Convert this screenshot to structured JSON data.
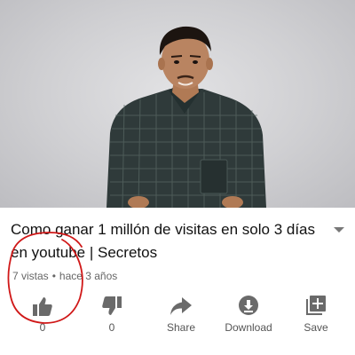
{
  "video": {
    "thumbnail_subject": "man-in-checkered-shirt"
  },
  "title": "Como ganar 1 millón de visitas en solo 3 días en youtube | Secretos",
  "meta": {
    "views": "7 vistas",
    "separator": "•",
    "age": "hace 3 años"
  },
  "actions": {
    "like": {
      "icon": "thumbs-up-icon",
      "count": "0"
    },
    "dislike": {
      "icon": "thumbs-down-icon",
      "count": "0"
    },
    "share": {
      "icon": "share-arrow-icon",
      "label": "Share"
    },
    "download": {
      "icon": "download-icon",
      "label": "Download"
    },
    "save": {
      "icon": "add-to-playlist-icon",
      "label": "Save"
    }
  },
  "colors": {
    "annotation": "#d01818",
    "icon": "#6a6a6a",
    "text": "#111111",
    "meta": "#666666"
  }
}
